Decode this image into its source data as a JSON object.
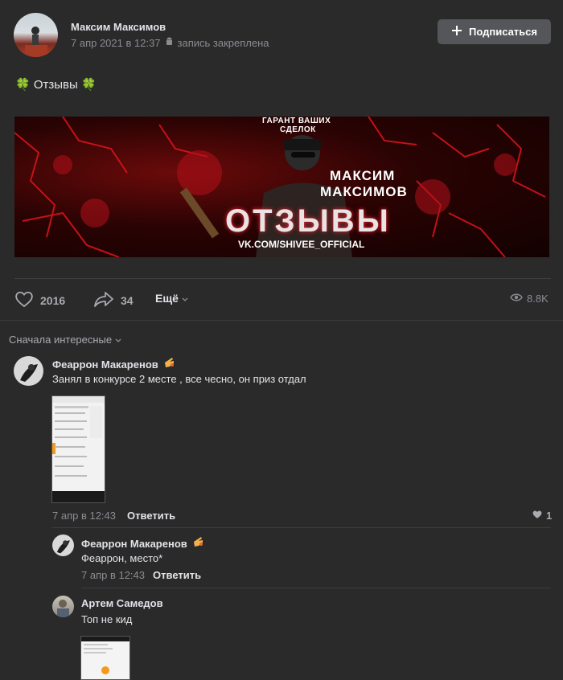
{
  "post": {
    "author": "Максим Максимов",
    "date": "7 апр 2021 в 12:37",
    "pinned_label": "запись закреплена",
    "subscribe_label": "Подписаться",
    "text": "🍀 Отзывы 🍀",
    "banner": {
      "top_line1": "ГАРАНТ ВАШИХ",
      "top_line2": "СДЕЛОК",
      "name_line1": "МАКСИМ",
      "name_line2": "МАКСИМОВ",
      "big_title": "ОТЗЫВЫ",
      "url": "VK.COM/SHIVEE_OFFICIAL"
    },
    "likes": "2016",
    "shares": "34",
    "more_label": "Ещё",
    "views": "8.8K"
  },
  "sort_label": "Сначала интересные",
  "comments": [
    {
      "author": "Феаррон Макаренов",
      "text": "Занял в конкурсе 2 месте , все чесно, он приз отдал",
      "date": "7 апр в 12:43",
      "reply_label": "Ответить",
      "likes": "1"
    },
    {
      "author": "Феаррон Макаренов",
      "text": "Феаррон, место*",
      "date": "7 апр в 12:43",
      "reply_label": "Ответить"
    },
    {
      "author": "Артем Самедов",
      "text": "Топ не кид"
    }
  ],
  "colors": {
    "background": "#2a2a2b",
    "accent_red": "#c0121a",
    "text": "#e1e3e6",
    "muted": "#8a8c90"
  },
  "icons": [
    "plus-icon",
    "android-icon",
    "heart-icon",
    "share-icon",
    "chevron-down-icon",
    "eye-icon",
    "hand-emoji-icon"
  ]
}
